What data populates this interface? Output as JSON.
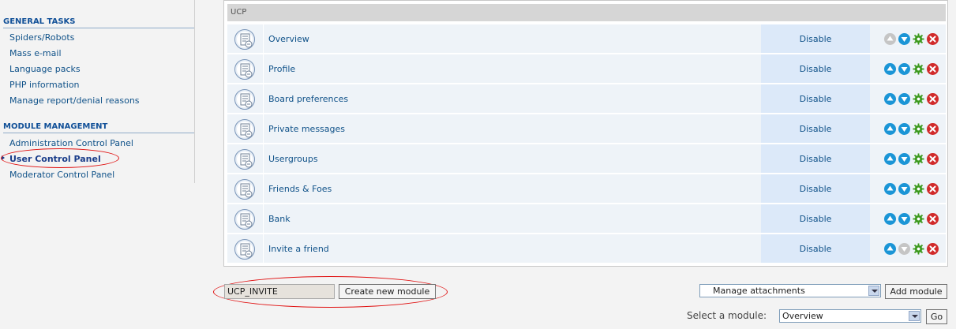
{
  "sidebar": {
    "general_tasks_title": "GENERAL TASKS",
    "general_tasks": [
      {
        "label": "Spiders/Robots"
      },
      {
        "label": "Mass e-mail"
      },
      {
        "label": "Language packs"
      },
      {
        "label": "PHP information"
      },
      {
        "label": "Manage report/denial reasons"
      }
    ],
    "module_management_title": "MODULE MANAGEMENT",
    "module_management": [
      {
        "label": "Administration Control Panel"
      },
      {
        "label": "User Control Panel",
        "active": true
      },
      {
        "label": "Moderator Control Panel"
      }
    ]
  },
  "main": {
    "table_title": "UCP",
    "modules": [
      {
        "name": "Overview",
        "status": "Disable",
        "up_enabled": false,
        "down_enabled": true
      },
      {
        "name": "Profile",
        "status": "Disable",
        "up_enabled": true,
        "down_enabled": true
      },
      {
        "name": "Board preferences",
        "status": "Disable",
        "up_enabled": true,
        "down_enabled": true
      },
      {
        "name": "Private messages",
        "status": "Disable",
        "up_enabled": true,
        "down_enabled": true
      },
      {
        "name": "Usergroups",
        "status": "Disable",
        "up_enabled": true,
        "down_enabled": true
      },
      {
        "name": "Friends & Foes",
        "status": "Disable",
        "up_enabled": true,
        "down_enabled": true
      },
      {
        "name": "Bank",
        "status": "Disable",
        "up_enabled": true,
        "down_enabled": true
      },
      {
        "name": "Invite a friend",
        "status": "Disable",
        "up_enabled": true,
        "down_enabled": false
      }
    ],
    "action_icons": [
      "move-up-icon",
      "move-down-icon",
      "gear-icon",
      "delete-icon"
    ]
  },
  "bottom": {
    "new_module_value": "UCP_INVITE",
    "create_button": "Create new module",
    "attachments_select": "Manage attachments",
    "add_module_button": "Add module",
    "select_module_label": "Select a module:",
    "select_module_value": "Overview",
    "go_button": "Go"
  },
  "colors": {
    "link": "#105289",
    "status_cell": "#dce9f9",
    "row_bg": "#eef3f8",
    "highlight_oval": "#e01010",
    "move_icon": "#1b95d6",
    "gear_icon": "#3c9a1e",
    "delete_icon": "#d12a2a"
  }
}
